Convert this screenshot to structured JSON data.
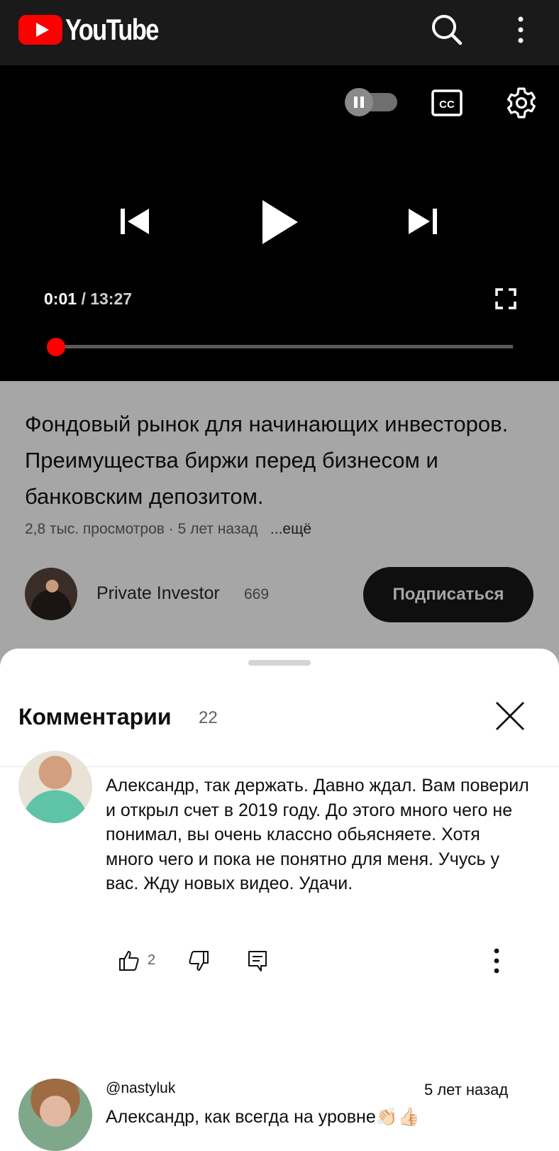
{
  "app": {
    "logo_text": "YouTube",
    "accent": "#ff0000"
  },
  "player": {
    "current_time": "0:01",
    "separator": "/",
    "duration": "13:27",
    "progress": 0.001
  },
  "video": {
    "title": "Фондовый рынок для начинающих инвесторов. Преимущества биржи перед бизнесом и банковским депозитом.",
    "meta": "2,8 тыс. просмотров · 5 лет назад",
    "more_label": "...ещё"
  },
  "channel": {
    "name": "Private Investor",
    "subscribers": "669",
    "subscribe_label": "Подписаться"
  },
  "comments": {
    "title": "Комментарии",
    "count": "22",
    "items": [
      {
        "text": "Александр, так держать. Давно ждал. Вам поверил и открыл счет в 2019 году. До этого много чего не понимал, вы очень классно обьясняете. Хотя много чего и пока не понятно для меня. Учусь у вас. Жду новых видео. Удачи.",
        "likes": "2"
      },
      {
        "author": "@nastyluk",
        "time": "5 лет назад",
        "text": "Александр, как всегда на уровне👏🏻👍🏻"
      }
    ]
  }
}
